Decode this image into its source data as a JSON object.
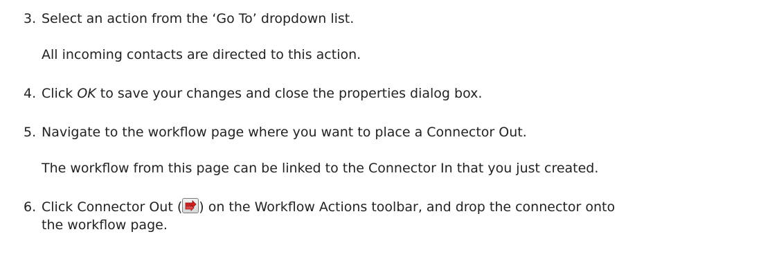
{
  "steps": [
    {
      "number": "3.",
      "text": "Select an action from the ‘Go To’ dropdown list.",
      "note": "All incoming contacts are directed to this action."
    },
    {
      "number": "4.",
      "text_before": "Click ",
      "text_em": "OK",
      "text_after": " to save your changes and close the properties dialog box."
    },
    {
      "number": "5.",
      "text": "Navigate to the workflow page where you want to place a Connector Out.",
      "note": "The workflow from this page can be linked to the Connector In that you just created."
    },
    {
      "number": "6.",
      "text_before": "Click Connector Out (",
      "text_after": ") on the Workflow Actions toolbar, and drop the connector onto",
      "text_line2": "the workflow page.",
      "icon": "connector-out-icon"
    }
  ],
  "colors": {
    "text": "#222222",
    "icon_red": "#d42020"
  }
}
